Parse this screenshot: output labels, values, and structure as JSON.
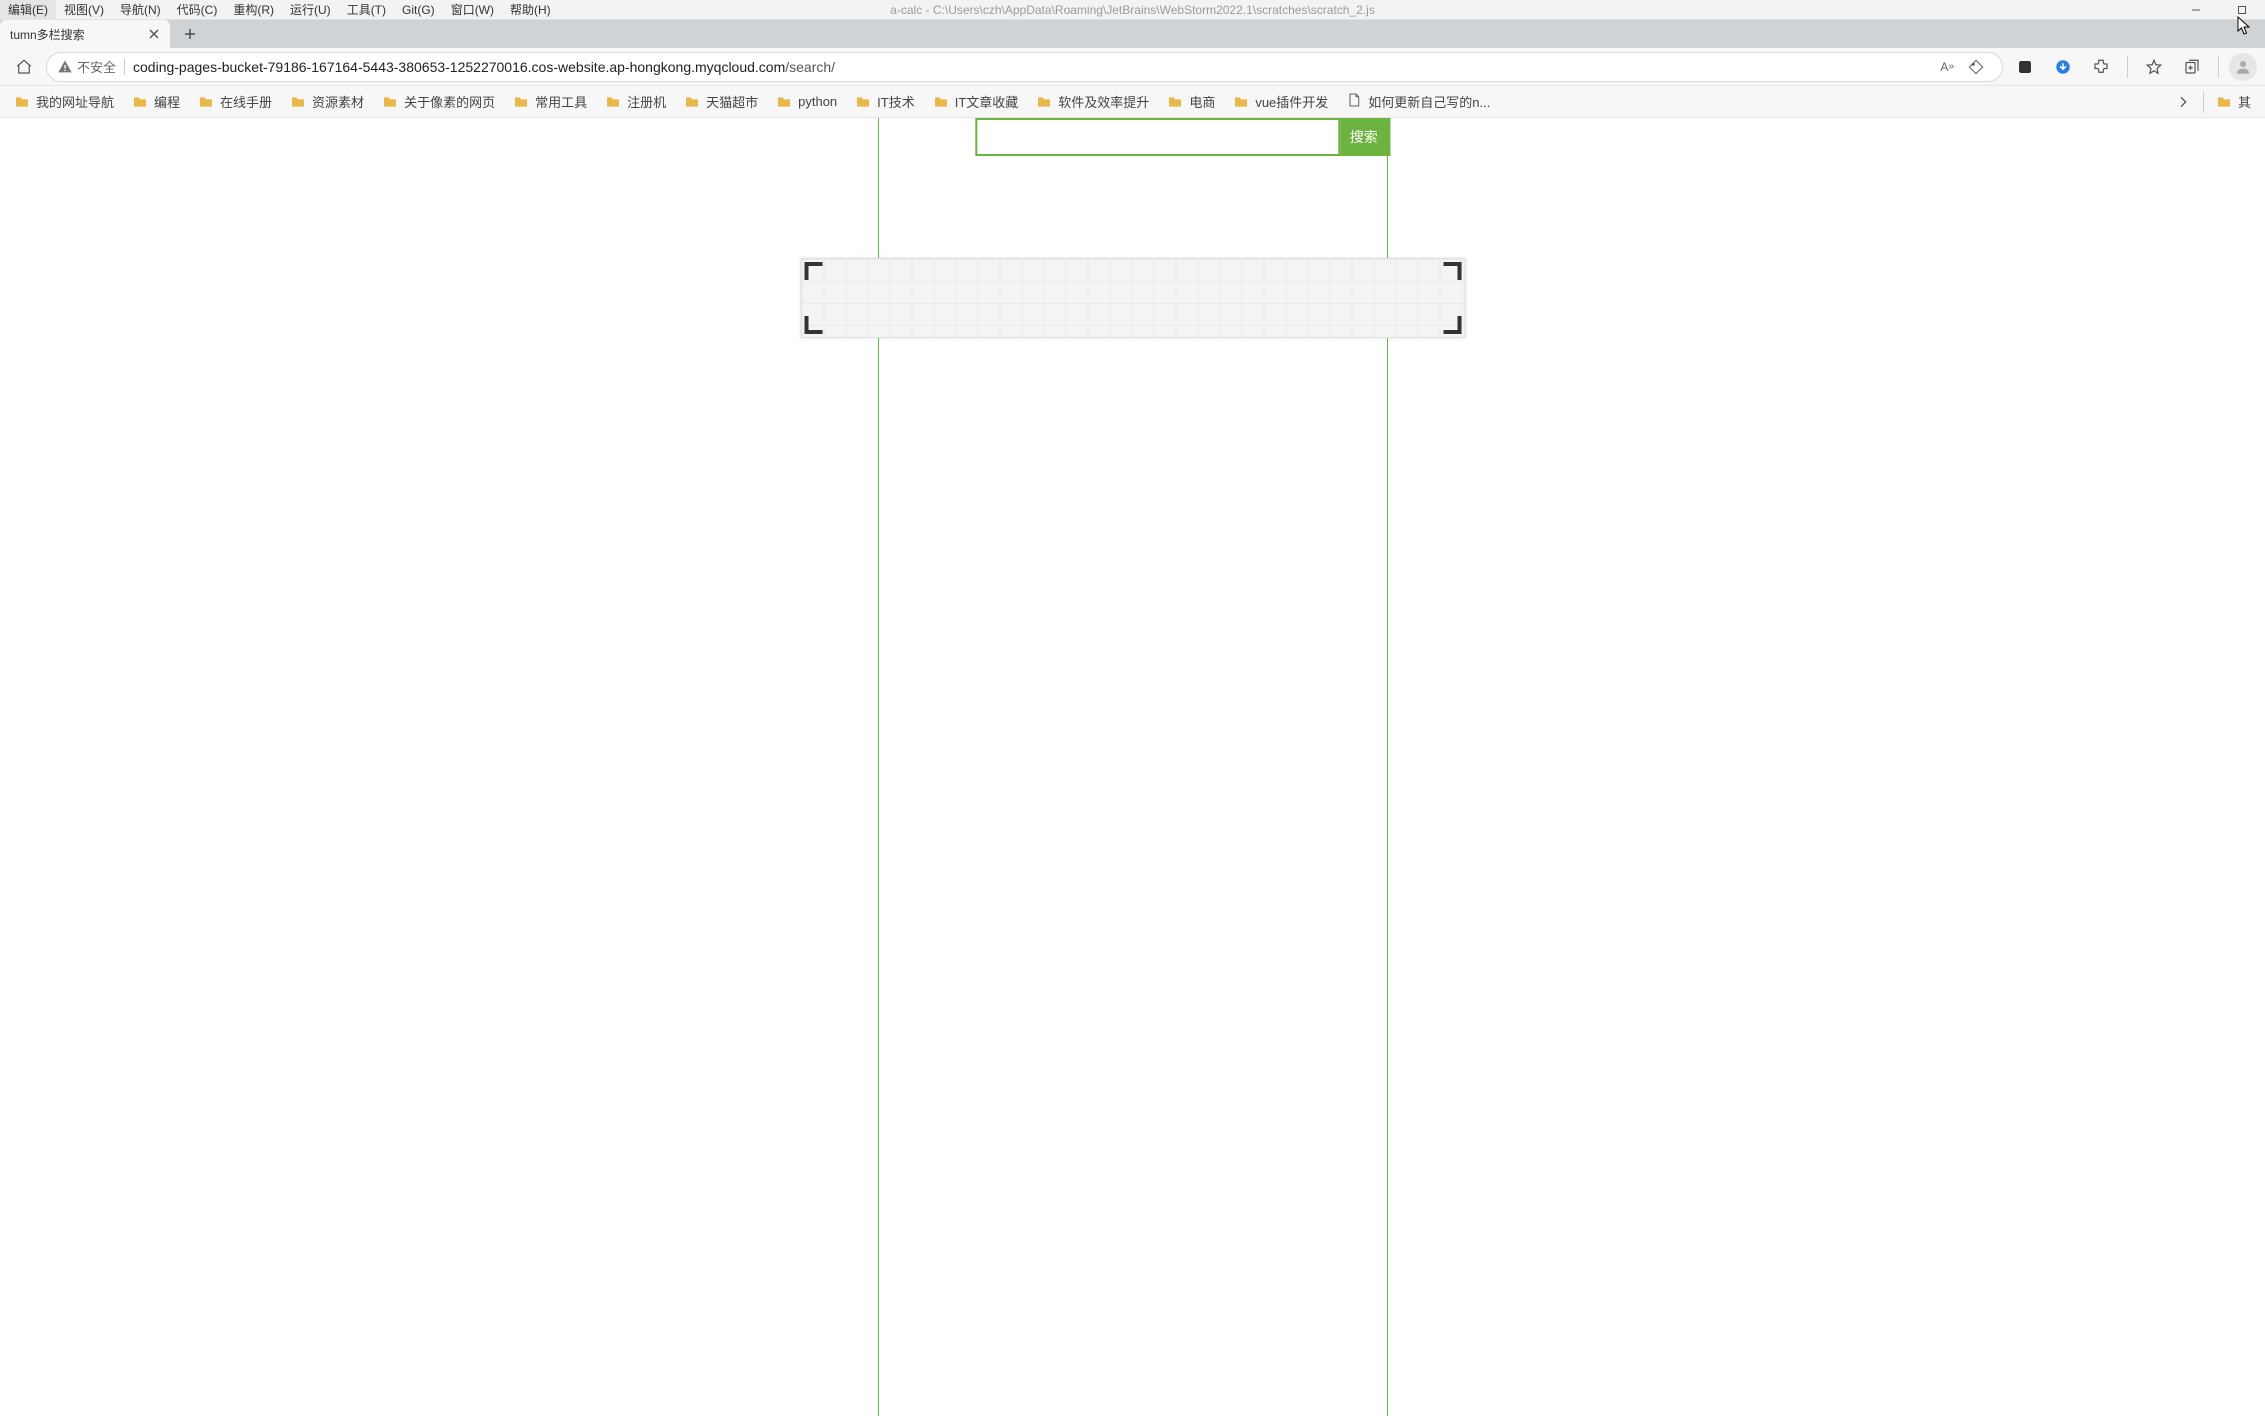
{
  "ide": {
    "menu": [
      "编辑(E)",
      "视图(V)",
      "导航(N)",
      "代码(C)",
      "重构(R)",
      "运行(U)",
      "工具(T)",
      "Git(G)",
      "窗口(W)",
      "帮助(H)"
    ],
    "title": "a-calc - C:\\Users\\czh\\AppData\\Roaming\\JetBrains\\WebStorm2022.1\\scratches\\scratch_2.js"
  },
  "browser": {
    "tab_title": "tumn多栏搜索",
    "security_label": "不安全",
    "url_host": "coding-pages-bucket-79186-167164-5443-380653-1252270016.cos-website.ap-hongkong.myqcloud.com",
    "url_path": "/search/"
  },
  "bookmarks": {
    "items": [
      {
        "label": "我的网址导航",
        "type": "folder"
      },
      {
        "label": "编程",
        "type": "folder"
      },
      {
        "label": "在线手册",
        "type": "folder"
      },
      {
        "label": "资源素材",
        "type": "folder"
      },
      {
        "label": "关于像素的网页",
        "type": "folder"
      },
      {
        "label": "常用工具",
        "type": "folder"
      },
      {
        "label": "注册机",
        "type": "folder"
      },
      {
        "label": "天猫超市",
        "type": "folder"
      },
      {
        "label": "python",
        "type": "folder"
      },
      {
        "label": "IT技术",
        "type": "folder"
      },
      {
        "label": "IT文章收藏",
        "type": "folder"
      },
      {
        "label": "软件及效率提升",
        "type": "folder"
      },
      {
        "label": "电商",
        "type": "folder"
      },
      {
        "label": "vue插件开发",
        "type": "folder"
      },
      {
        "label": "如何更新自己写的n...",
        "type": "page"
      }
    ],
    "overflow_label": "其"
  },
  "page": {
    "search_button": "搜索",
    "search_value": ""
  }
}
